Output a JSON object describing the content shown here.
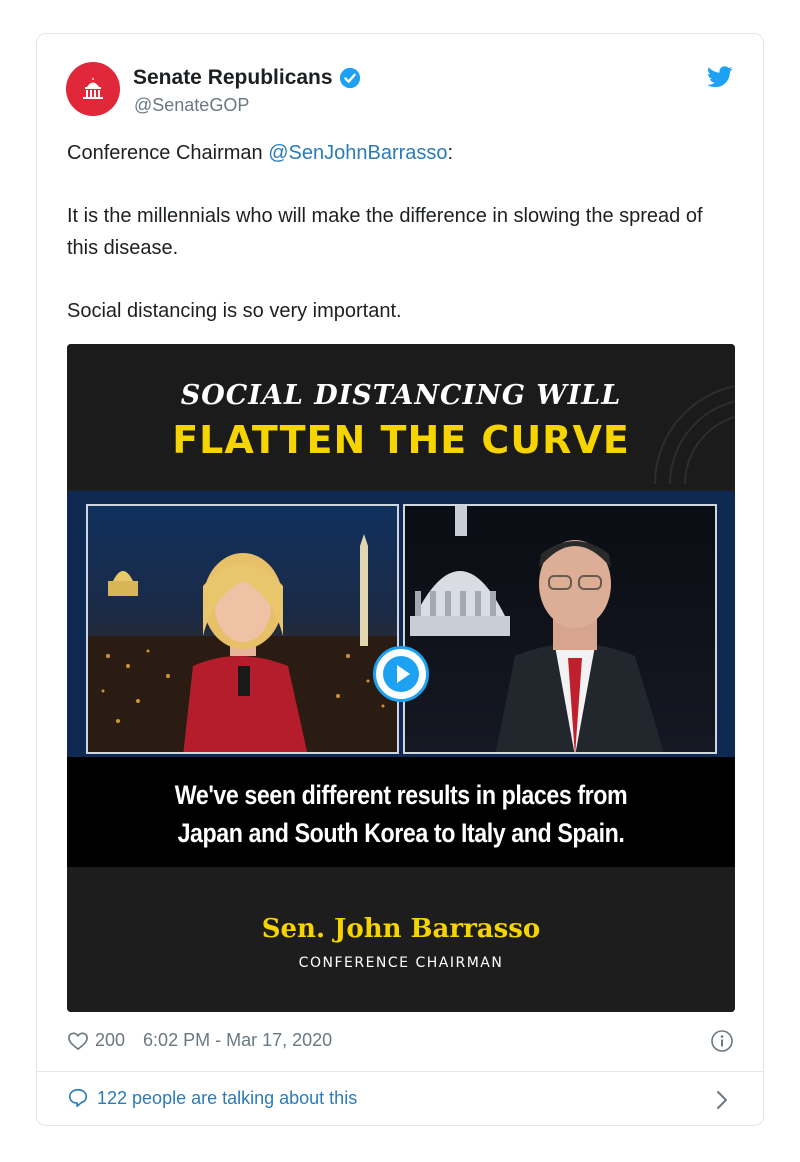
{
  "author": {
    "display_name": "Senate Republicans",
    "handle": "@SenateGOP"
  },
  "tweet": {
    "line1_prefix": "Conference Chairman ",
    "line1_mention": "@SenJohnBarrasso",
    "line1_suffix": ":",
    "paragraph2": "It is the millennials who will make the difference in slowing the spread of this disease.",
    "paragraph3": "Social distancing is so very important."
  },
  "media": {
    "headline_top": "SOCIAL DISTANCING WILL",
    "headline_bottom": "FLATTEN THE CURVE",
    "caption_line1": "We've seen different results in places from",
    "caption_line2": "Japan and South Korea to Italy and Spain.",
    "speaker_name": "Sen. John Barrasso",
    "speaker_title": "CONFERENCE CHAIRMAN"
  },
  "meta": {
    "likes": "200",
    "timestamp": "6:02 PM - Mar 17, 2020"
  },
  "footer": {
    "talking": "122 people are talking about this"
  },
  "colors": {
    "twitter_blue": "#1da1f2",
    "link_blue": "#2b7bb9",
    "avatar_red": "#e0283a",
    "headline_yellow": "#f5d400"
  },
  "icons": [
    "capitol-icon",
    "verified-icon",
    "twitter-bird-icon",
    "play-icon",
    "heart-icon",
    "info-icon",
    "speech-bubble-icon",
    "chevron-right-icon"
  ]
}
